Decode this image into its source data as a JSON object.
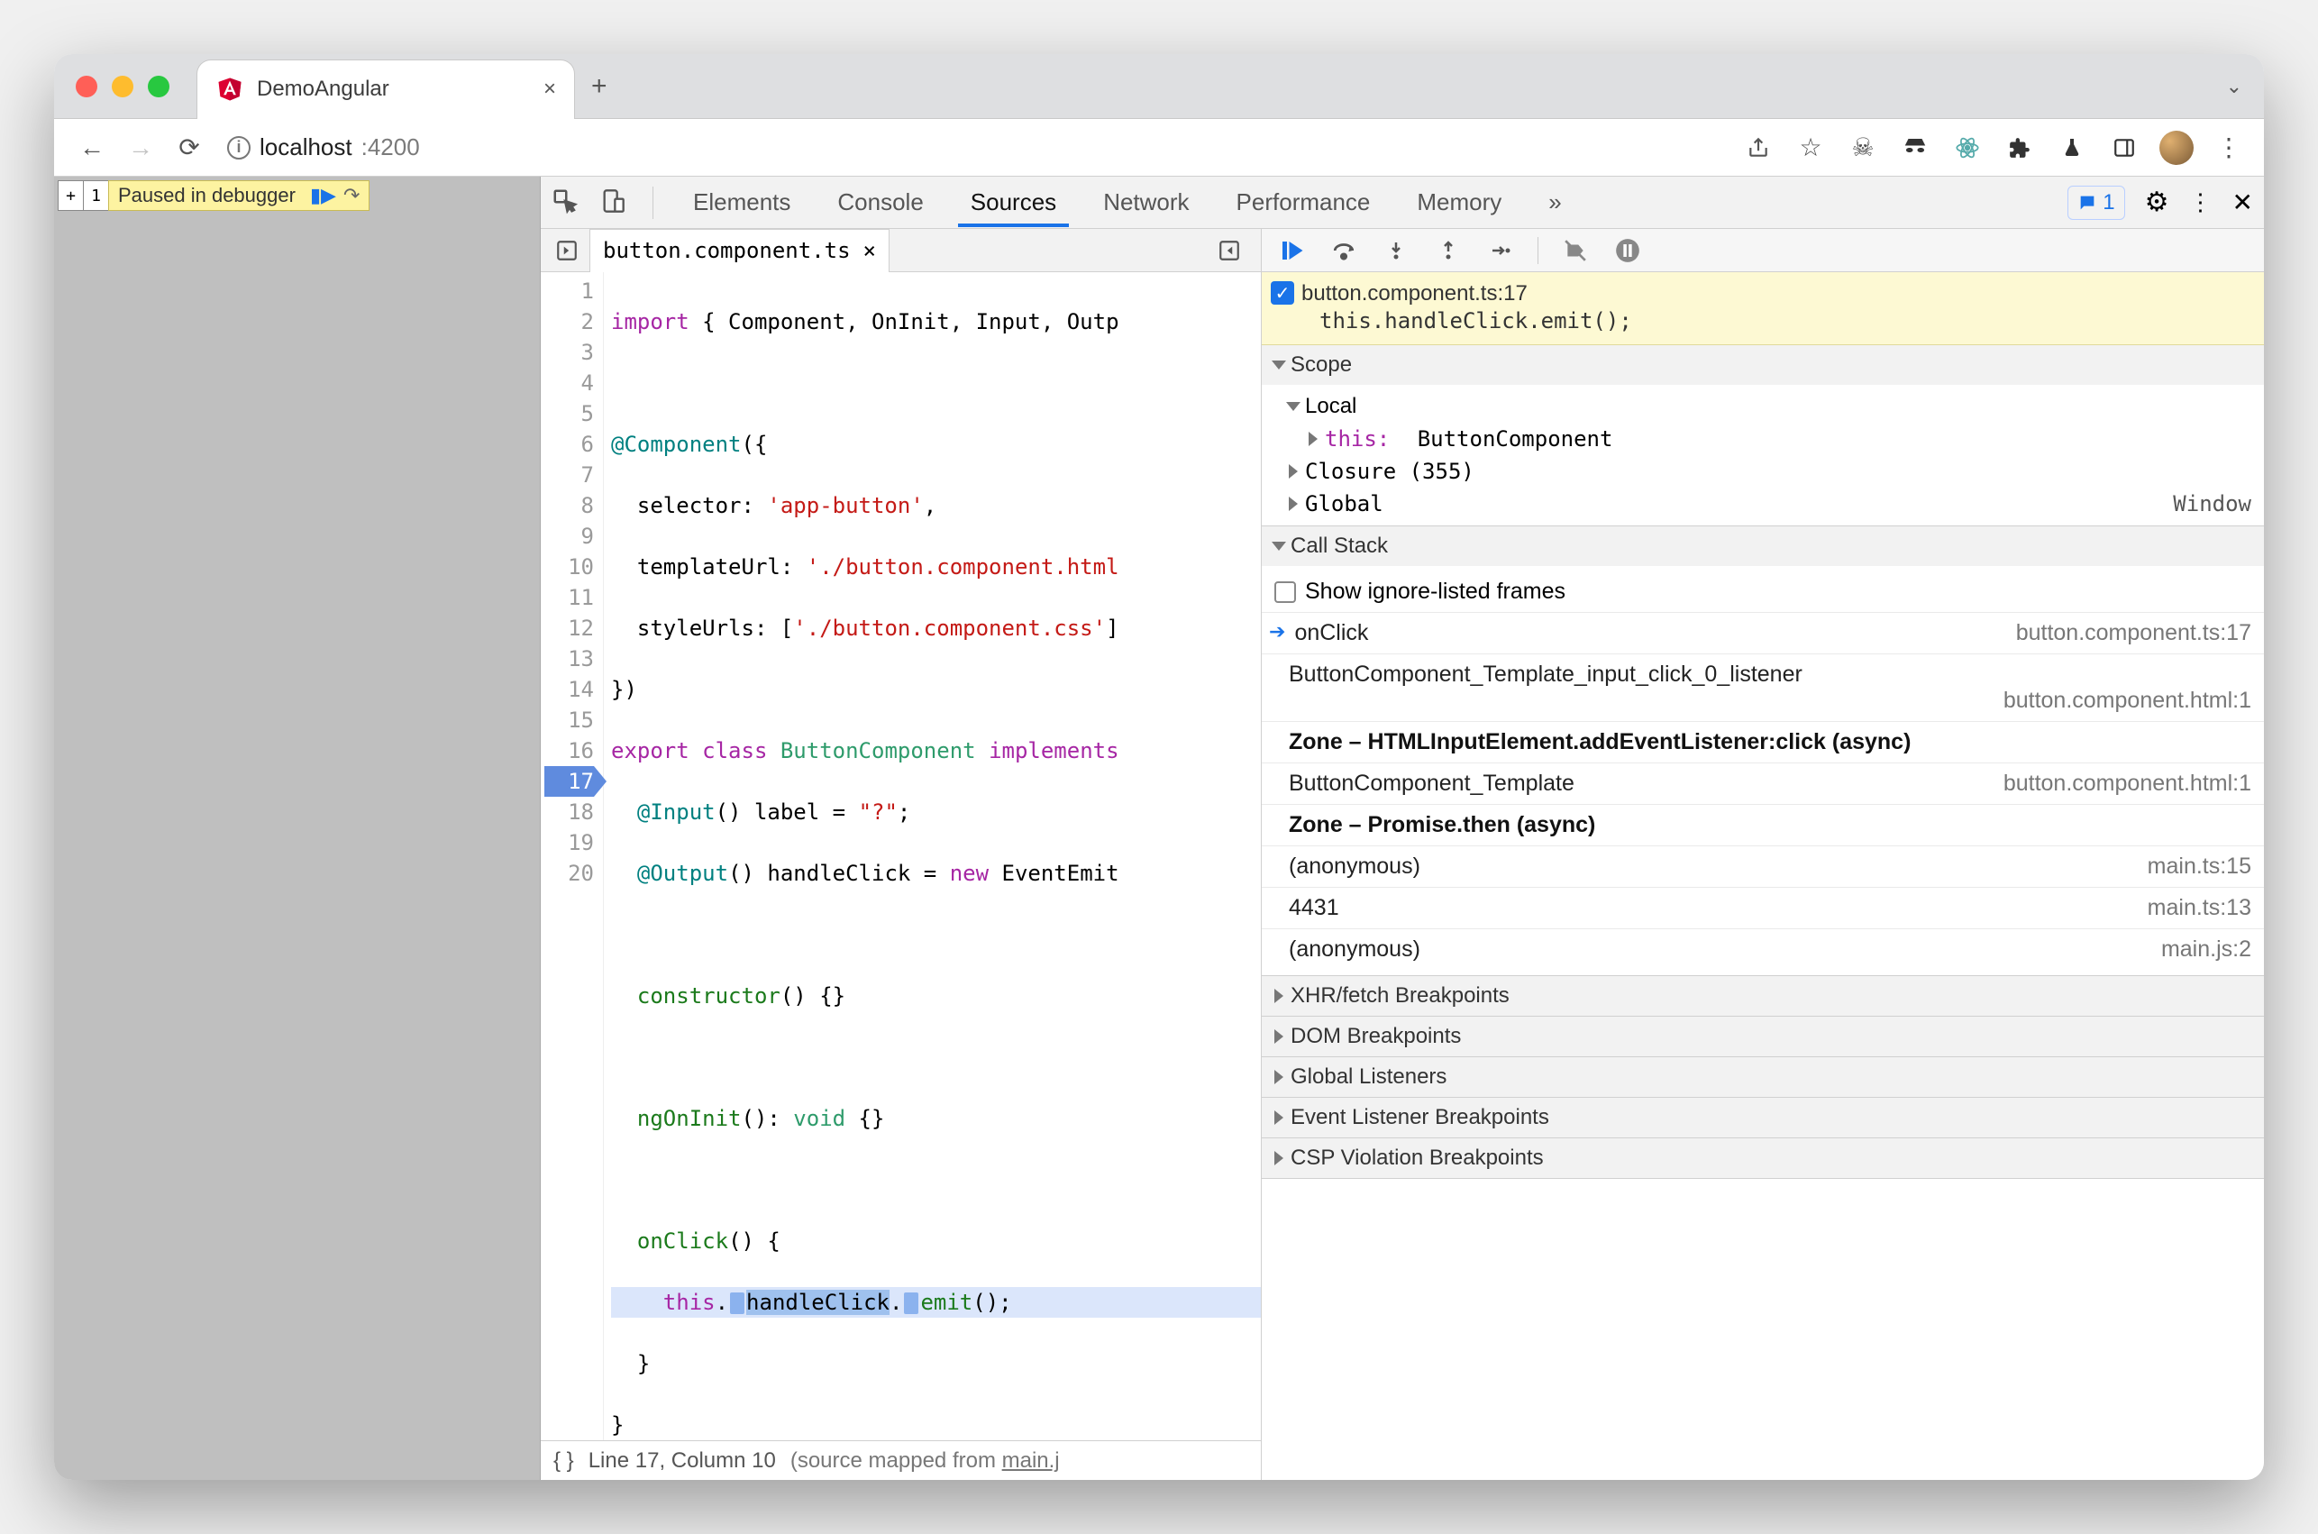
{
  "window": {
    "tab_title": "DemoAngular",
    "new_tab": "+",
    "url_host": "localhost",
    "url_port": ":4200"
  },
  "page": {
    "paused_label": "Paused in debugger",
    "bp_count": "1"
  },
  "devtools": {
    "tabs": [
      "Elements",
      "Console",
      "Sources",
      "Network",
      "Performance",
      "Memory"
    ],
    "more": "»",
    "issues_count": "1"
  },
  "editor": {
    "file": "button.component.ts",
    "lines": {
      "1": "import { Component, OnInit, Input, Outp",
      "2": "",
      "3": "@Component({",
      "4": "  selector: 'app-button',",
      "5": "  templateUrl: './button.component.html",
      "6": "  styleUrls: ['./button.component.css']",
      "7": "})",
      "8": "export class ButtonComponent implements",
      "9": "  @Input() label = \"?\";",
      "10": "  @Output() handleClick = new EventEmit",
      "11": "",
      "12": "  constructor() {}",
      "13": "",
      "14": "  ngOnInit(): void {}",
      "15": "",
      "16": "  onClick() {",
      "17": "    this.handleClick.emit();",
      "18": "  }",
      "19": "}",
      "20": ""
    },
    "status_prefix": "Line 17, Column 10",
    "status_suffix": "(source mapped from ",
    "status_link": "main.j"
  },
  "breakpoint_callout": {
    "location": "button.component.ts:17",
    "code": "this.handleClick.emit();"
  },
  "scope": {
    "header": "Scope",
    "local": "Local",
    "this_label": "this:",
    "this_type": "ButtonComponent",
    "closure": "Closure (355)",
    "global": "Global",
    "global_value": "Window"
  },
  "callstack": {
    "header": "Call Stack",
    "show_ignored": "Show ignore-listed frames",
    "frames": [
      {
        "name": "onClick",
        "loc": "button.component.ts:17",
        "current": true
      },
      {
        "name": "ButtonComponent_Template_input_click_0_listener",
        "loc": "button.component.html:1"
      },
      {
        "name": "Zone – HTMLInputElement.addEventListener:click (async)",
        "zone": true
      },
      {
        "name": "ButtonComponent_Template",
        "loc": "button.component.html:1"
      },
      {
        "name": "Zone – Promise.then (async)",
        "zone": true
      },
      {
        "name": "(anonymous)",
        "loc": "main.ts:15"
      },
      {
        "name": "4431",
        "loc": "main.ts:13"
      },
      {
        "name": "(anonymous)",
        "loc": "main.js:2"
      }
    ]
  },
  "panels": {
    "xhr": "XHR/fetch Breakpoints",
    "dom": "DOM Breakpoints",
    "gl": "Global Listeners",
    "elb": "Event Listener Breakpoints",
    "csp": "CSP Violation Breakpoints"
  }
}
